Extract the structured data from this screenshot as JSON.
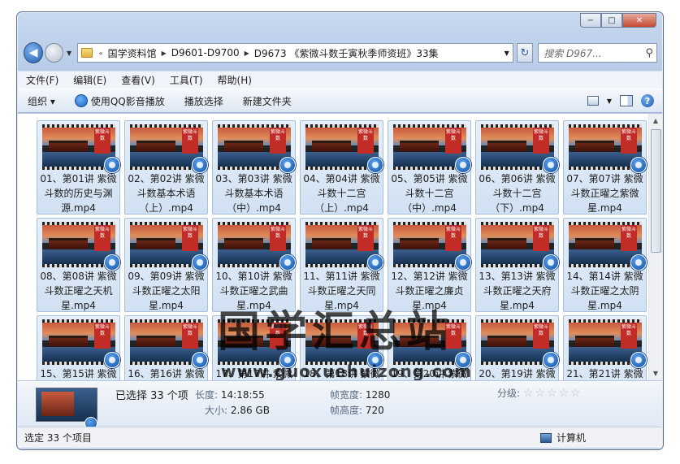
{
  "window": {
    "caption": {
      "min": "−",
      "max": "□",
      "close": "✕"
    }
  },
  "nav": {
    "back_glyph": "◀",
    "breadcrumb": [
      "国学资料馆",
      "D9601-D9700",
      "D9673 《紫微斗数壬寅秋季师资班》33集"
    ],
    "refresh_glyph": "↻",
    "search_placeholder": "搜索 D967...",
    "search_glyph": "⚲"
  },
  "menu": [
    "文件(F)",
    "编辑(E)",
    "查看(V)",
    "工具(T)",
    "帮助(H)"
  ],
  "toolbar": {
    "organize": "组织 ▾",
    "qq_play": "使用QQ影音播放",
    "play_selection": "播放选择",
    "new_folder": "新建文件夹",
    "help_glyph": "?"
  },
  "files": [
    "01、第01讲 紫微斗数的历史与渊源.mp4",
    "02、第02讲 紫微斗数基本术语（上）.mp4",
    "03、第03讲 紫微斗数基本术语（中）.mp4",
    "04、第04讲 紫微斗数十二宫（上）.mp4",
    "05、第05讲 紫微斗数十二宫（中）.mp4",
    "06、第06讲 紫微斗数十二宫（下）.mp4",
    "07、第07讲 紫微斗数正曜之紫微星.mp4",
    "08、第08讲 紫微斗数正曜之天机星.mp4",
    "09、第09讲 紫微斗数正曜之太阳星.mp4",
    "10、第10讲 紫微斗数正曜之武曲星.mp4",
    "11、第11讲 紫微斗数正曜之天同星.mp4",
    "12、第12讲 紫微斗数正曜之廉贞星.mp4",
    "13、第13讲 紫微斗数正曜之天府星.mp4",
    "14、第14讲 紫微斗数正曜之太阴星.mp4",
    "15、第15讲 紫微",
    "16、第16讲 紫微",
    "17、第17讲 紫微",
    "18、第18讲 紫微",
    "19、第20讲 紫微",
    "20、第19讲 紫微",
    "21、第21讲 紫微"
  ],
  "thumb_banner": "紫微斗数",
  "watermark": {
    "title": "国学汇总站",
    "url": "www.guoxuehuizong.com"
  },
  "details": {
    "selected": "已选择 33 个项",
    "length_key": "长度:",
    "length_val": "14:18:55",
    "size_key": "大小:",
    "size_val": "2.86 GB",
    "width_key": "帧宽度:",
    "width_val": "1280",
    "height_key": "帧高度:",
    "height_val": "720",
    "rating_key": "分级:",
    "rating_stars": "☆☆☆☆☆"
  },
  "status": {
    "left": "选定 33 个项目",
    "right": "计算机"
  }
}
